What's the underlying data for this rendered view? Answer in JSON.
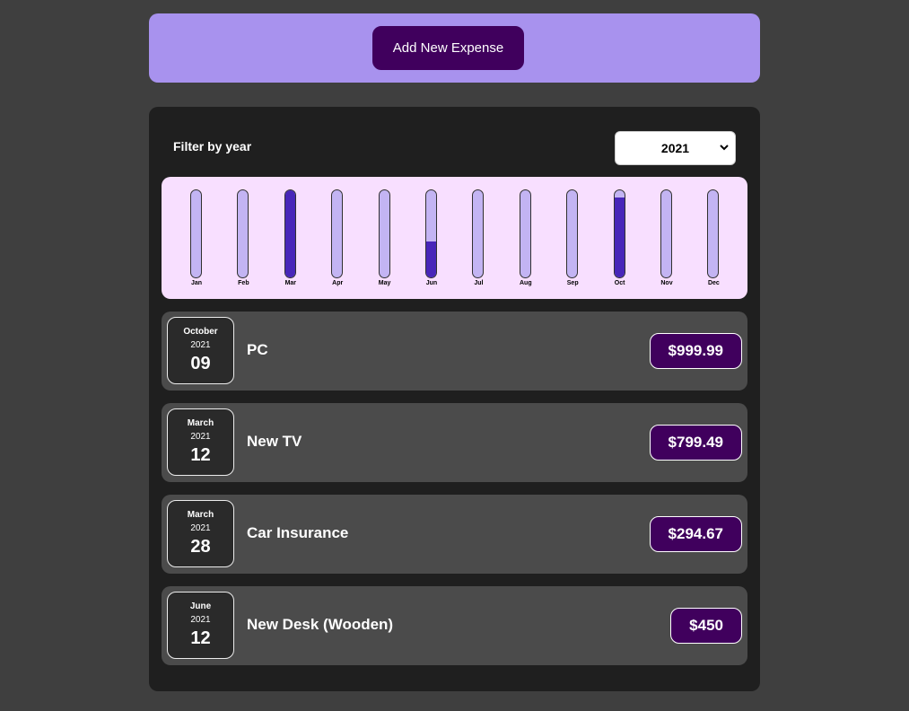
{
  "new_expense": {
    "add_button_label": "Add New Expense"
  },
  "filter": {
    "label": "Filter by year",
    "selected_year": "2021"
  },
  "chart_data": {
    "type": "bar",
    "categories": [
      "Jan",
      "Feb",
      "Mar",
      "Apr",
      "May",
      "Jun",
      "Jul",
      "Aug",
      "Sep",
      "Oct",
      "Nov",
      "Dec"
    ],
    "values": [
      0,
      0,
      1094.16,
      0,
      0,
      450,
      0,
      0,
      0,
      999.99,
      0,
      0
    ],
    "ylim": [
      0,
      1094.16
    ]
  },
  "expenses": [
    {
      "month": "October",
      "year": "2021",
      "day": "09",
      "title": "PC",
      "amount": "$999.99"
    },
    {
      "month": "March",
      "year": "2021",
      "day": "12",
      "title": "New TV",
      "amount": "$799.49"
    },
    {
      "month": "March",
      "year": "2021",
      "day": "28",
      "title": "Car Insurance",
      "amount": "$294.67"
    },
    {
      "month": "June",
      "year": "2021",
      "day": "12",
      "title": "New Desk (Wooden)",
      "amount": "$450"
    }
  ]
}
